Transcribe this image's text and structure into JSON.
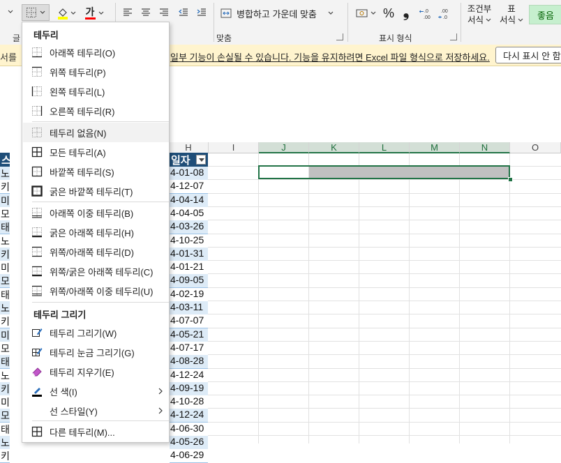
{
  "ribbon": {
    "merge_center_label": "병합하고 가운데 맞춤",
    "percent_symbol": "%",
    "comma_symbol": "❟",
    "conditional_format": [
      "조건부",
      "서식"
    ],
    "table_format": [
      "표",
      "서식"
    ],
    "good_style": "좋음",
    "group_labels": {
      "font_partial": "글",
      "alignment": "맞춤",
      "number": "표시 형식"
    },
    "font_color_letter": "가",
    "accent_colors": {
      "fill": "#ffff00",
      "font": "#ff0000"
    }
  },
  "message_bar": {
    "left_text": "서를",
    "text": "일부 기능이 손실될 수 있습니다. 기능을 유지하려면 Excel 파일 형식으로 저장하세요.",
    "button": "다시 표시 안 함"
  },
  "grid": {
    "column_headers": [
      "H",
      "I",
      "J",
      "K",
      "L",
      "M",
      "N",
      "O"
    ],
    "table_header": {
      "left_cell": "스",
      "date_header": "일자"
    },
    "left_column": [
      "노",
      "키",
      "미",
      "모",
      "태",
      "노",
      "키",
      "미",
      "모",
      "태",
      "노",
      "키",
      "미",
      "모",
      "태",
      "노",
      "키",
      "미",
      "모",
      "태",
      "노",
      "키"
    ],
    "dates": [
      "4-01-08",
      "4-12-07",
      "4-04-14",
      "4-04-05",
      "4-03-26",
      "4-10-25",
      "4-01-31",
      "4-01-21",
      "4-09-05",
      "4-02-19",
      "4-03-11",
      "4-07-07",
      "4-05-21",
      "4-07-17",
      "4-08-28",
      "4-12-24",
      "4-09-19",
      "4-10-28",
      "4-12-24",
      "4-06-30",
      "4-05-26",
      "4-06-29"
    ]
  },
  "menu": {
    "heading_borders": "테두리",
    "heading_draw": "테두리 그리기",
    "items": [
      {
        "label": "아래쪽 테두리(O)",
        "icon": "bottom-border-icon"
      },
      {
        "label": "위쪽 테두리(P)",
        "icon": "top-border-icon"
      },
      {
        "label": "왼쪽 테두리(L)",
        "icon": "left-border-icon"
      },
      {
        "label": "오른쪽 테두리(R)",
        "icon": "right-border-icon"
      },
      {
        "label": "테두리 없음(N)",
        "icon": "no-border-icon"
      },
      {
        "label": "모든 테두리(A)",
        "icon": "all-borders-icon"
      },
      {
        "label": "바깥쪽 테두리(S)",
        "icon": "outside-borders-icon"
      },
      {
        "label": "굵은 바깥쪽 테두리(T)",
        "icon": "thick-outside-borders-icon"
      },
      {
        "label": "아래쪽 이중 테두리(B)",
        "icon": "bottom-double-border-icon"
      },
      {
        "label": "굵은 아래쪽 테두리(H)",
        "icon": "thick-bottom-border-icon"
      },
      {
        "label": "위쪽/아래쪽 테두리(D)",
        "icon": "top-bottom-border-icon"
      },
      {
        "label": "위쪽/굵은 아래쪽 테두리(C)",
        "icon": "top-thick-bottom-border-icon"
      },
      {
        "label": "위쪽/아래쪽 이중 테두리(U)",
        "icon": "top-double-bottom-border-icon"
      }
    ],
    "draw_items": [
      {
        "label": "테두리 그리기(W)",
        "icon": "draw-border-icon"
      },
      {
        "label": "테두리 눈금 그리기(G)",
        "icon": "draw-border-grid-icon"
      },
      {
        "label": "테두리 지우기(E)",
        "icon": "eraser-icon"
      },
      {
        "label": "선 색(I)",
        "icon": "line-color-icon"
      },
      {
        "label": "선 스타일(Y)",
        "icon": "line-style-icon"
      },
      {
        "label": "다른 테두리(M)...",
        "icon": "more-borders-icon"
      }
    ]
  }
}
